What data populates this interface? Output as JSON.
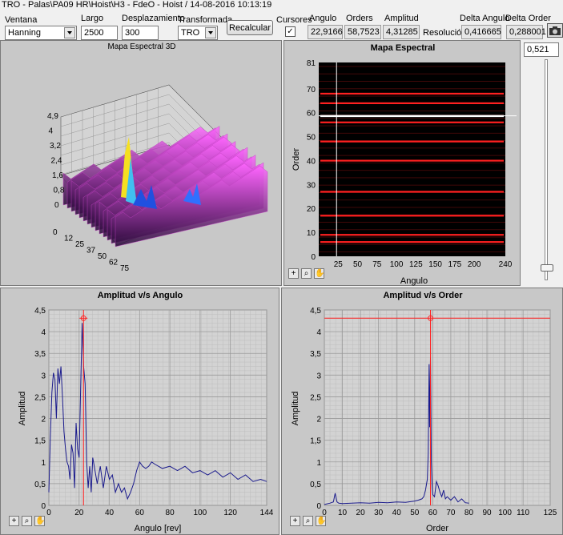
{
  "window_title": "TRO - Palas\\PA09 HR\\Hoist\\H3 - FdeO - Hoist / 14-08-2016 10:13:19",
  "controls": {
    "ventana_label": "Ventana",
    "ventana_value": "Hanning",
    "largo_label": "Largo",
    "largo_value": "2500",
    "desplazamiento_label": "Desplazamiento",
    "desplazamiento_value": "300",
    "transformada_label": "Transformada",
    "transformada_value": "TRO",
    "recalcular_label": "Recalcular",
    "cursores_label": "Cursores",
    "cursores_checked": "✓",
    "angulo_label": "Angulo",
    "angulo_value": "22,9166",
    "orders_label": "Orders",
    "orders_value": "58,7523",
    "amplitud_label": "Amplitud",
    "amplitud_value": "4,31285",
    "resolucion_label": "Resolución",
    "delta_angulo_label": "Delta Angulo",
    "delta_angulo_value": "0,416665",
    "delta_order_label": "Delta Order",
    "delta_order_value": "0,288001",
    "slider_value": "0,521",
    "slider_level": 0.04
  },
  "map3d": {
    "title": "Mapa Espectral 3D",
    "z_ticks": [
      "4,9",
      "4",
      "3,2",
      "2,4",
      "1,6",
      "0,8",
      "0"
    ],
    "order_ticks": [
      "0",
      "12",
      "25",
      "37",
      "50",
      "62",
      "75"
    ]
  },
  "chart_data": [
    {
      "type": "heatmap",
      "title": "Mapa Espectral",
      "xlabel": "Angulo",
      "ylabel": "Order",
      "xlim": [
        0,
        240
      ],
      "ylim": [
        0,
        81
      ],
      "x_ticks": [
        "25",
        "50",
        "75",
        "100",
        "125",
        "150",
        "175",
        "200",
        "240"
      ],
      "y_ticks": [
        "0",
        "10",
        "20",
        "30",
        "40",
        "50",
        "60",
        "70",
        "81"
      ],
      "bright_orders": [
        6,
        9,
        17,
        27,
        40,
        48,
        56,
        58.7,
        64,
        68
      ],
      "colors": {
        "background": "#000000",
        "lines": "#ff2020",
        "hot": "#ffffff"
      },
      "cursor": {
        "x": 22.9,
        "y": 58.7
      }
    },
    {
      "type": "line",
      "title": "Amplitud v/s Angulo",
      "xlabel": "Angulo [rev]",
      "ylabel": "Amplitud",
      "xlim": [
        0,
        144
      ],
      "ylim": [
        0,
        4.5
      ],
      "x_ticks": [
        "0",
        "20",
        "40",
        "60",
        "80",
        "100",
        "120",
        "144"
      ],
      "y_ticks": [
        "0",
        "0,5",
        "1",
        "1,5",
        "2",
        "2,5",
        "3",
        "3,5",
        "4",
        "4,5"
      ],
      "cursor": {
        "x": 22.9,
        "y": 4.31
      },
      "series": [
        {
          "color": "#1a1a8c",
          "x": [
            0,
            1,
            2,
            3,
            4,
            5,
            6,
            7,
            8,
            9,
            10,
            11,
            12,
            13,
            14,
            15,
            16,
            17,
            18,
            19,
            20,
            21,
            22,
            23,
            24,
            25,
            26,
            27,
            28,
            29,
            30,
            32,
            34,
            36,
            38,
            40,
            42,
            44,
            46,
            48,
            50,
            52,
            54,
            56,
            58,
            60,
            62,
            64,
            66,
            68,
            70,
            75,
            80,
            85,
            90,
            95,
            100,
            105,
            110,
            115,
            120,
            125,
            130,
            135,
            140,
            144
          ],
          "y": [
            0.3,
            1.6,
            2.6,
            3.05,
            2.9,
            2.0,
            3.15,
            2.8,
            3.2,
            2.5,
            1.7,
            1.3,
            1.0,
            0.9,
            0.6,
            1.4,
            1.2,
            0.4,
            1.9,
            1.3,
            1.1,
            2.7,
            4.2,
            3.2,
            2.8,
            1.0,
            0.4,
            0.9,
            0.3,
            1.1,
            0.9,
            0.5,
            0.9,
            0.4,
            0.9,
            0.6,
            0.7,
            0.3,
            0.5,
            0.3,
            0.4,
            0.15,
            0.3,
            0.5,
            0.8,
            1.0,
            0.9,
            0.85,
            0.9,
            1.0,
            0.95,
            0.85,
            0.9,
            0.8,
            0.9,
            0.75,
            0.8,
            0.7,
            0.8,
            0.65,
            0.75,
            0.6,
            0.7,
            0.55,
            0.6,
            0.55
          ]
        }
      ]
    },
    {
      "type": "line",
      "title": "Amplitud v/s Order",
      "xlabel": "Order",
      "ylabel": "Amplitud",
      "xlim": [
        0,
        125
      ],
      "ylim": [
        0,
        4.5
      ],
      "x_ticks": [
        "0",
        "10",
        "20",
        "30",
        "40",
        "50",
        "60",
        "70",
        "80",
        "90",
        "100",
        "110",
        "125"
      ],
      "y_ticks": [
        "0",
        "0,5",
        "1",
        "1,5",
        "2",
        "2,5",
        "3",
        "3,5",
        "4",
        "4,5"
      ],
      "cursor": {
        "x": 58.75,
        "y": 4.31
      },
      "series": [
        {
          "color": "#1a1a8c",
          "x": [
            0,
            3,
            5,
            6,
            7,
            8,
            10,
            15,
            20,
            25,
            30,
            35,
            40,
            45,
            50,
            52,
            54,
            55,
            56,
            57,
            57.5,
            58,
            58.3,
            58.75,
            59.2,
            59.6,
            60,
            61,
            62,
            63,
            64,
            65,
            66,
            67,
            68,
            70,
            72,
            74,
            76,
            78,
            80
          ],
          "y": [
            0.02,
            0.05,
            0.08,
            0.28,
            0.08,
            0.05,
            0.04,
            0.05,
            0.06,
            0.05,
            0.07,
            0.06,
            0.08,
            0.07,
            0.1,
            0.12,
            0.15,
            0.2,
            0.35,
            0.6,
            1.2,
            3.25,
            1.8,
            3.4,
            1.0,
            0.5,
            0.25,
            0.2,
            0.55,
            0.45,
            0.3,
            0.2,
            0.35,
            0.15,
            0.2,
            0.12,
            0.2,
            0.08,
            0.15,
            0.06,
            0.05
          ]
        }
      ]
    }
  ]
}
